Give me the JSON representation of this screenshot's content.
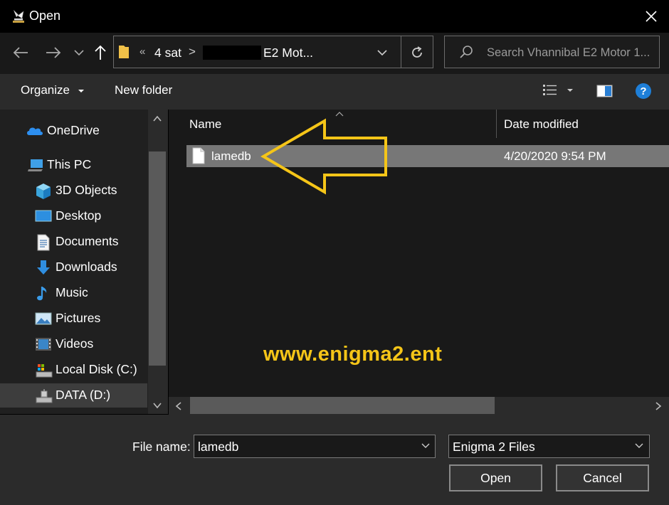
{
  "window": {
    "title": "Open"
  },
  "address": {
    "crumb_more": "«",
    "crumb_1": "4 sat",
    "crumb_sep": ">",
    "crumb_2": "E2 Mot..."
  },
  "search": {
    "placeholder": "Search Vhannibal E2 Motor 1..."
  },
  "toolbar": {
    "organize": "Organize",
    "new_folder": "New folder"
  },
  "sidebar": {
    "items": [
      {
        "label": "OneDrive"
      },
      {
        "label": "This PC"
      },
      {
        "label": "3D Objects"
      },
      {
        "label": "Desktop"
      },
      {
        "label": "Documents"
      },
      {
        "label": "Downloads"
      },
      {
        "label": "Music"
      },
      {
        "label": "Pictures"
      },
      {
        "label": "Videos"
      },
      {
        "label": "Local Disk (C:)"
      },
      {
        "label": "DATA (D:)"
      }
    ]
  },
  "files": {
    "columns": {
      "name": "Name",
      "date": "Date modified"
    },
    "rows": [
      {
        "name": "lamedb",
        "date": "4/20/2020 9:54 PM"
      }
    ]
  },
  "watermark": "www.enigma2.ent",
  "footer": {
    "file_name_label": "File name:",
    "file_name_value": "lamedb",
    "file_type": "Enigma 2 Files",
    "open": "Open",
    "cancel": "Cancel"
  },
  "colors": {
    "arrow": "#f5c518",
    "accent": "#1e7fd8"
  }
}
